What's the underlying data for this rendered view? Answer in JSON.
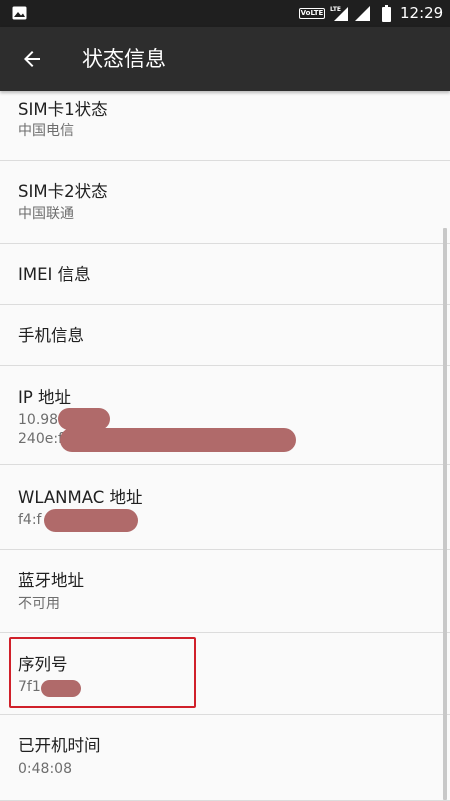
{
  "status_bar": {
    "time": "12:29",
    "volte_label": "VoLTE",
    "lte_label": "LTE",
    "icons": [
      "image-icon",
      "volte-icon",
      "lte-signal-icon",
      "signal-icon",
      "battery-icon"
    ]
  },
  "app_bar": {
    "title": "状态信息",
    "back_icon": "arrow-left-icon"
  },
  "items": [
    {
      "title": "SIM卡1状态",
      "summary": "中国电信"
    },
    {
      "title": "SIM卡2状态",
      "summary": "中国联通"
    },
    {
      "title": "IMEI 信息",
      "summary": ""
    },
    {
      "title": "手机信息",
      "summary": ""
    },
    {
      "title": "IP 地址",
      "summary": "10.98",
      "summary2": "240e:f"
    },
    {
      "title": "WLANMAC 地址",
      "summary": "f4:f"
    },
    {
      "title": "蓝牙地址",
      "summary": "不可用"
    },
    {
      "title": "序列号",
      "summary": "7f1"
    },
    {
      "title": "已开机时间",
      "summary": "0:48:08"
    }
  ],
  "colors": {
    "status_bar_bg": "#1f1f1f",
    "app_bar_bg": "#2d2d2d",
    "page_bg": "#fafafa",
    "divider": "#dcdcdc",
    "redaction": "#b06a6a",
    "highlight_border": "#d0202a"
  }
}
